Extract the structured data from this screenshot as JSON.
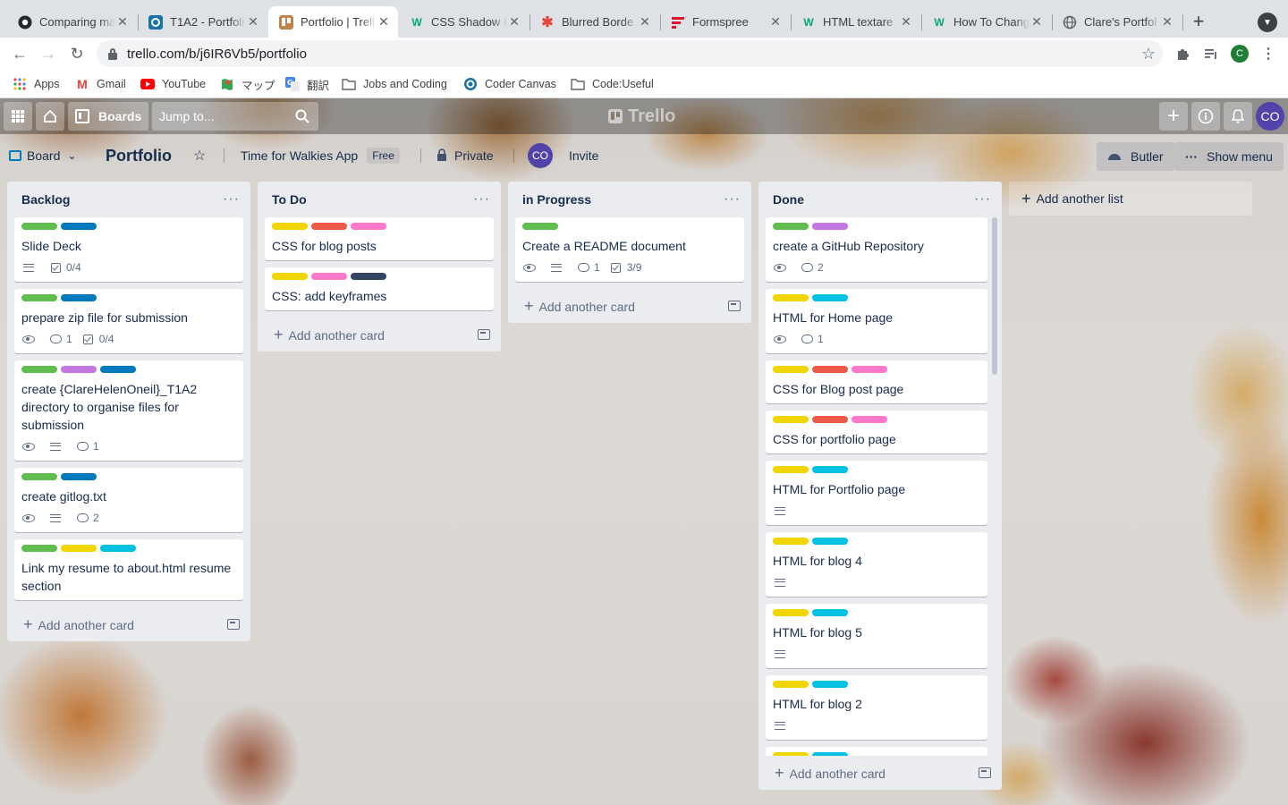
{
  "browser": {
    "tabs": [
      {
        "title": "Comparing ma",
        "icon": "github-icon",
        "active": false
      },
      {
        "title": "T1A2 - Portfoli",
        "icon": "coder-canvas-icon",
        "active": false
      },
      {
        "title": "Portfolio | Trell",
        "icon": "trello-icon",
        "active": true
      },
      {
        "title": "CSS Shadow E",
        "icon": "w3-icon",
        "active": false
      },
      {
        "title": "Blurred Borde",
        "icon": "asterisk-icon",
        "active": false
      },
      {
        "title": "Formspree",
        "icon": "formspree-icon",
        "active": false
      },
      {
        "title": "HTML textare",
        "icon": "w3-icon",
        "active": false
      },
      {
        "title": "How To Chang",
        "icon": "w3-icon",
        "active": false
      },
      {
        "title": "Clare's Portfol",
        "icon": "globe-icon",
        "active": false
      }
    ],
    "url": "trello.com/b/j6IR6Vb5/portfolio",
    "profile_initial": "C",
    "bookmarks": [
      {
        "label": "Apps"
      },
      {
        "label": "Gmail"
      },
      {
        "label": "YouTube"
      },
      {
        "label": "マップ"
      },
      {
        "label": "翻訳"
      },
      {
        "label": "Jobs and Coding"
      },
      {
        "label": "Coder Canvas"
      },
      {
        "label": "Code:Useful"
      }
    ]
  },
  "trello": {
    "header": {
      "boards_label": "Boards",
      "search_placeholder": "Jump to...",
      "logo": "Trello",
      "user_initials": "CO"
    },
    "board": {
      "view_label": "Board",
      "name": "Portfolio",
      "team": "Time for Walkies App",
      "team_badge": "Free",
      "visibility": "Private",
      "member_initials": "CO",
      "invite_label": "Invite",
      "butler_label": "Butler",
      "show_menu_label": "Show menu",
      "add_list_label": "Add another list",
      "add_card_label": "Add another card"
    },
    "label_colors": {
      "green": "#61bd4f",
      "blue": "#0079bf",
      "purple": "#c377e0",
      "yellow": "#f2d600",
      "red": "#eb5a46",
      "pink": "#ff78cb",
      "navy": "#344563",
      "sky": "#00c2e0"
    },
    "lists": [
      {
        "title": "Backlog",
        "cards": [
          {
            "labels": [
              "green",
              "blue"
            ],
            "title": "Slide Deck",
            "badges": [
              {
                "icon": "description-icon"
              },
              {
                "icon": "checklist-icon",
                "text": "0/4"
              }
            ]
          },
          {
            "labels": [
              "green",
              "blue"
            ],
            "title": "prepare zip file for submission",
            "badges": [
              {
                "icon": "watch-icon"
              },
              {
                "icon": "comment-icon",
                "text": "1"
              },
              {
                "icon": "checklist-icon",
                "text": "0/4"
              }
            ]
          },
          {
            "labels": [
              "green",
              "purple",
              "blue"
            ],
            "title": "create {ClareHelenOneil}_T1A2 directory to organise files for submission",
            "badges": [
              {
                "icon": "watch-icon"
              },
              {
                "icon": "description-icon"
              },
              {
                "icon": "comment-icon",
                "text": "1"
              }
            ]
          },
          {
            "labels": [
              "green",
              "blue"
            ],
            "title": "create gitlog.txt",
            "badges": [
              {
                "icon": "watch-icon"
              },
              {
                "icon": "description-icon"
              },
              {
                "icon": "comment-icon",
                "text": "2"
              }
            ]
          },
          {
            "labels": [
              "green",
              "yellow",
              "sky"
            ],
            "title": "Link my resume to about.html resume section",
            "badges": []
          }
        ]
      },
      {
        "title": "To Do",
        "cards": [
          {
            "labels": [
              "yellow",
              "red",
              "pink"
            ],
            "title": "CSS for blog posts",
            "badges": []
          },
          {
            "labels": [
              "yellow",
              "pink",
              "navy"
            ],
            "title": "CSS: add keyframes",
            "badges": []
          }
        ]
      },
      {
        "title": "in Progress",
        "cards": [
          {
            "labels": [
              "green"
            ],
            "title": "Create a README document",
            "badges": [
              {
                "icon": "watch-icon"
              },
              {
                "icon": "description-icon"
              },
              {
                "icon": "comment-icon",
                "text": "1"
              },
              {
                "icon": "checklist-icon",
                "text": "3/9"
              }
            ]
          }
        ]
      },
      {
        "title": "Done",
        "cards": [
          {
            "labels": [
              "green",
              "purple"
            ],
            "title": "create a GitHub Repository",
            "badges": [
              {
                "icon": "watch-icon"
              },
              {
                "icon": "comment-icon",
                "text": "2"
              }
            ]
          },
          {
            "labels": [
              "yellow",
              "sky"
            ],
            "title": "HTML for Home page",
            "badges": [
              {
                "icon": "watch-icon"
              },
              {
                "icon": "comment-icon",
                "text": "1"
              }
            ]
          },
          {
            "labels": [
              "yellow",
              "red",
              "pink"
            ],
            "title": "CSS for Blog post page",
            "badges": []
          },
          {
            "labels": [
              "yellow",
              "red",
              "pink"
            ],
            "title": "CSS for portfolio page",
            "badges": []
          },
          {
            "labels": [
              "yellow",
              "sky"
            ],
            "title": "HTML for Portfolio page",
            "badges": [
              {
                "icon": "description-icon"
              }
            ]
          },
          {
            "labels": [
              "yellow",
              "sky"
            ],
            "title": "HTML for blog 4",
            "badges": [
              {
                "icon": "description-icon"
              }
            ]
          },
          {
            "labels": [
              "yellow",
              "sky"
            ],
            "title": "HTML for blog 5",
            "badges": [
              {
                "icon": "description-icon"
              }
            ]
          },
          {
            "labels": [
              "yellow",
              "sky"
            ],
            "title": "HTML for blog 2",
            "badges": [
              {
                "icon": "description-icon"
              }
            ]
          },
          {
            "labels": [
              "yellow",
              "sky"
            ],
            "title": "",
            "badges": []
          }
        ]
      }
    ]
  }
}
